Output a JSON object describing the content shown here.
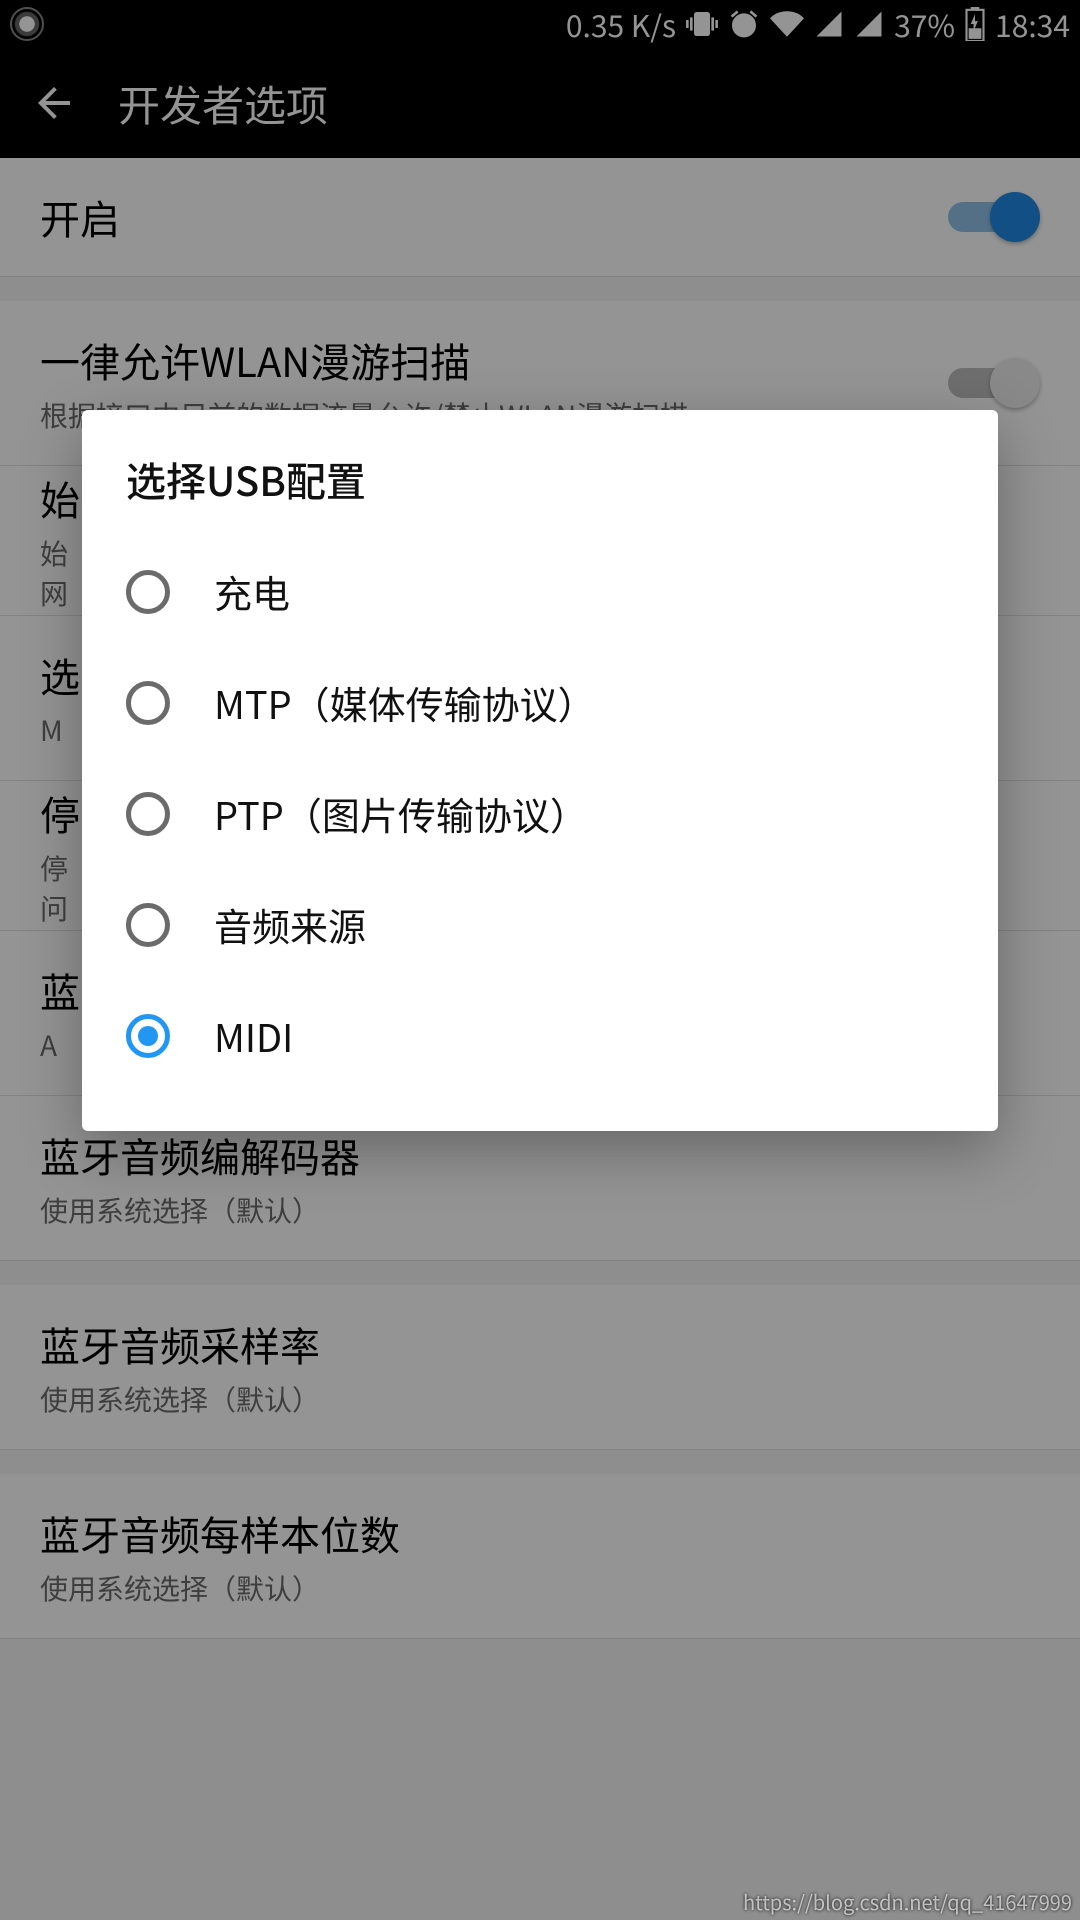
{
  "status": {
    "net_speed": "0.35 K/s",
    "battery_pct": "37%",
    "time": "18:34"
  },
  "appbar": {
    "title": "开发者选项"
  },
  "settings": [
    {
      "title": "开启",
      "sub": "",
      "toggle": "on"
    },
    {
      "title": "一律允许WLAN漫游扫描",
      "sub": "根据接口中目前的数据流量允许/禁止WLAN漫游扫描",
      "toggle": "off"
    },
    {
      "title": "始",
      "sub": "始\n网"
    },
    {
      "title": "选",
      "sub": "M"
    },
    {
      "title": "停",
      "sub": "停\n问"
    },
    {
      "title": "蓝",
      "sub": "A"
    },
    {
      "title": "蓝牙音频编解码器",
      "sub": "使用系统选择（默认）"
    },
    {
      "title": "蓝牙音频采样率",
      "sub": "使用系统选择（默认）"
    },
    {
      "title": "蓝牙音频每样本位数",
      "sub": "使用系统选择（默认）"
    }
  ],
  "dialog": {
    "title": "选择USB配置",
    "options": [
      {
        "label": "充电",
        "selected": false
      },
      {
        "label": "MTP（媒体传输协议）",
        "selected": false
      },
      {
        "label": "PTP（图片传输协议）",
        "selected": false
      },
      {
        "label": "音频来源",
        "selected": false
      },
      {
        "label": "MIDI",
        "selected": true
      }
    ]
  },
  "watermark": "https://blog.csdn.net/qq_41647999"
}
